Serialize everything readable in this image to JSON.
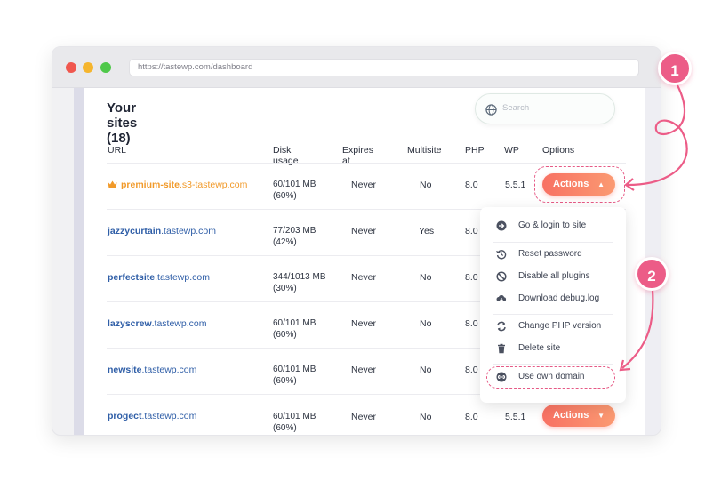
{
  "browser": {
    "url": "https://tastewp.com/dashboard"
  },
  "page": {
    "title": "Your sites (18)"
  },
  "search": {
    "placeholder": "Search"
  },
  "table": {
    "headers": {
      "url": "URL",
      "disk": "Disk usage",
      "expires": "Expires at",
      "multisite": "Multisite",
      "php": "PHP",
      "wp": "WP",
      "options": "Options"
    },
    "rows": [
      {
        "name": "premium-site",
        "domain": ".s3-tastewp.com",
        "disk_line1": "60/101 MB",
        "disk_line2": "(60%)",
        "expires": "Never",
        "multisite": "No",
        "php": "8.0",
        "wp": "5.5.1",
        "premium": true
      },
      {
        "name": "jazzycurtain",
        "domain": ".tastewp.com",
        "disk_line1": "77/203 MB",
        "disk_line2": "(42%)",
        "expires": "Never",
        "multisite": "Yes",
        "php": "8.0",
        "wp": ""
      },
      {
        "name": "perfectsite",
        "domain": ".tastewp.com",
        "disk_line1": "344/1013 MB",
        "disk_line2": "(30%)",
        "expires": "Never",
        "multisite": "No",
        "php": "8.0",
        "wp": ""
      },
      {
        "name": "lazyscrew",
        "domain": ".tastewp.com",
        "disk_line1": "60/101 MB",
        "disk_line2": "(60%)",
        "expires": "Never",
        "multisite": "No",
        "php": "8.0",
        "wp": ""
      },
      {
        "name": "newsite",
        "domain": ".tastewp.com",
        "disk_line1": "60/101 MB",
        "disk_line2": "(60%)",
        "expires": "Never",
        "multisite": "No",
        "php": "8.0",
        "wp": ""
      },
      {
        "name": "progect",
        "domain": ".tastewp.com",
        "disk_line1": "60/101 MB",
        "disk_line2": "(60%)",
        "expires": "Never",
        "multisite": "No",
        "php": "8.0",
        "wp": "5.5.1"
      }
    ]
  },
  "actions": {
    "label": "Actions"
  },
  "menu": {
    "items": [
      {
        "label": "Go & login to site",
        "icon": "arrow-circle-right-icon"
      },
      {
        "label": "Reset password",
        "icon": "history-icon"
      },
      {
        "label": "Disable all plugins",
        "icon": "ban-icon"
      },
      {
        "label": "Download debug.log",
        "icon": "cloud-download-icon"
      },
      {
        "label": "Change PHP version",
        "icon": "sync-icon"
      },
      {
        "label": "Delete site",
        "icon": "trash-icon"
      },
      {
        "label": "Use own domain",
        "icon": "link-icon"
      }
    ]
  },
  "callouts": {
    "one": "1",
    "two": "2"
  },
  "colors": {
    "accent": "#f87163",
    "link": "#2f5ea7",
    "premium": "#f19a2a",
    "callout": "#ec5c87"
  }
}
